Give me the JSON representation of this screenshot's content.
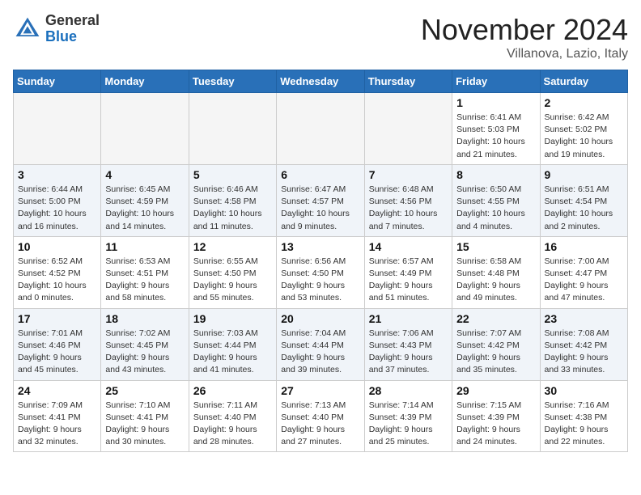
{
  "header": {
    "logo_general": "General",
    "logo_blue": "Blue",
    "month_title": "November 2024",
    "location": "Villanova, Lazio, Italy"
  },
  "weekdays": [
    "Sunday",
    "Monday",
    "Tuesday",
    "Wednesday",
    "Thursday",
    "Friday",
    "Saturday"
  ],
  "weeks": [
    [
      {
        "day": "",
        "info": ""
      },
      {
        "day": "",
        "info": ""
      },
      {
        "day": "",
        "info": ""
      },
      {
        "day": "",
        "info": ""
      },
      {
        "day": "",
        "info": ""
      },
      {
        "day": "1",
        "info": "Sunrise: 6:41 AM\nSunset: 5:03 PM\nDaylight: 10 hours\nand 21 minutes."
      },
      {
        "day": "2",
        "info": "Sunrise: 6:42 AM\nSunset: 5:02 PM\nDaylight: 10 hours\nand 19 minutes."
      }
    ],
    [
      {
        "day": "3",
        "info": "Sunrise: 6:44 AM\nSunset: 5:00 PM\nDaylight: 10 hours\nand 16 minutes."
      },
      {
        "day": "4",
        "info": "Sunrise: 6:45 AM\nSunset: 4:59 PM\nDaylight: 10 hours\nand 14 minutes."
      },
      {
        "day": "5",
        "info": "Sunrise: 6:46 AM\nSunset: 4:58 PM\nDaylight: 10 hours\nand 11 minutes."
      },
      {
        "day": "6",
        "info": "Sunrise: 6:47 AM\nSunset: 4:57 PM\nDaylight: 10 hours\nand 9 minutes."
      },
      {
        "day": "7",
        "info": "Sunrise: 6:48 AM\nSunset: 4:56 PM\nDaylight: 10 hours\nand 7 minutes."
      },
      {
        "day": "8",
        "info": "Sunrise: 6:50 AM\nSunset: 4:55 PM\nDaylight: 10 hours\nand 4 minutes."
      },
      {
        "day": "9",
        "info": "Sunrise: 6:51 AM\nSunset: 4:54 PM\nDaylight: 10 hours\nand 2 minutes."
      }
    ],
    [
      {
        "day": "10",
        "info": "Sunrise: 6:52 AM\nSunset: 4:52 PM\nDaylight: 10 hours\nand 0 minutes."
      },
      {
        "day": "11",
        "info": "Sunrise: 6:53 AM\nSunset: 4:51 PM\nDaylight: 9 hours\nand 58 minutes."
      },
      {
        "day": "12",
        "info": "Sunrise: 6:55 AM\nSunset: 4:50 PM\nDaylight: 9 hours\nand 55 minutes."
      },
      {
        "day": "13",
        "info": "Sunrise: 6:56 AM\nSunset: 4:50 PM\nDaylight: 9 hours\nand 53 minutes."
      },
      {
        "day": "14",
        "info": "Sunrise: 6:57 AM\nSunset: 4:49 PM\nDaylight: 9 hours\nand 51 minutes."
      },
      {
        "day": "15",
        "info": "Sunrise: 6:58 AM\nSunset: 4:48 PM\nDaylight: 9 hours\nand 49 minutes."
      },
      {
        "day": "16",
        "info": "Sunrise: 7:00 AM\nSunset: 4:47 PM\nDaylight: 9 hours\nand 47 minutes."
      }
    ],
    [
      {
        "day": "17",
        "info": "Sunrise: 7:01 AM\nSunset: 4:46 PM\nDaylight: 9 hours\nand 45 minutes."
      },
      {
        "day": "18",
        "info": "Sunrise: 7:02 AM\nSunset: 4:45 PM\nDaylight: 9 hours\nand 43 minutes."
      },
      {
        "day": "19",
        "info": "Sunrise: 7:03 AM\nSunset: 4:44 PM\nDaylight: 9 hours\nand 41 minutes."
      },
      {
        "day": "20",
        "info": "Sunrise: 7:04 AM\nSunset: 4:44 PM\nDaylight: 9 hours\nand 39 minutes."
      },
      {
        "day": "21",
        "info": "Sunrise: 7:06 AM\nSunset: 4:43 PM\nDaylight: 9 hours\nand 37 minutes."
      },
      {
        "day": "22",
        "info": "Sunrise: 7:07 AM\nSunset: 4:42 PM\nDaylight: 9 hours\nand 35 minutes."
      },
      {
        "day": "23",
        "info": "Sunrise: 7:08 AM\nSunset: 4:42 PM\nDaylight: 9 hours\nand 33 minutes."
      }
    ],
    [
      {
        "day": "24",
        "info": "Sunrise: 7:09 AM\nSunset: 4:41 PM\nDaylight: 9 hours\nand 32 minutes."
      },
      {
        "day": "25",
        "info": "Sunrise: 7:10 AM\nSunset: 4:41 PM\nDaylight: 9 hours\nand 30 minutes."
      },
      {
        "day": "26",
        "info": "Sunrise: 7:11 AM\nSunset: 4:40 PM\nDaylight: 9 hours\nand 28 minutes."
      },
      {
        "day": "27",
        "info": "Sunrise: 7:13 AM\nSunset: 4:40 PM\nDaylight: 9 hours\nand 27 minutes."
      },
      {
        "day": "28",
        "info": "Sunrise: 7:14 AM\nSunset: 4:39 PM\nDaylight: 9 hours\nand 25 minutes."
      },
      {
        "day": "29",
        "info": "Sunrise: 7:15 AM\nSunset: 4:39 PM\nDaylight: 9 hours\nand 24 minutes."
      },
      {
        "day": "30",
        "info": "Sunrise: 7:16 AM\nSunset: 4:38 PM\nDaylight: 9 hours\nand 22 minutes."
      }
    ]
  ]
}
